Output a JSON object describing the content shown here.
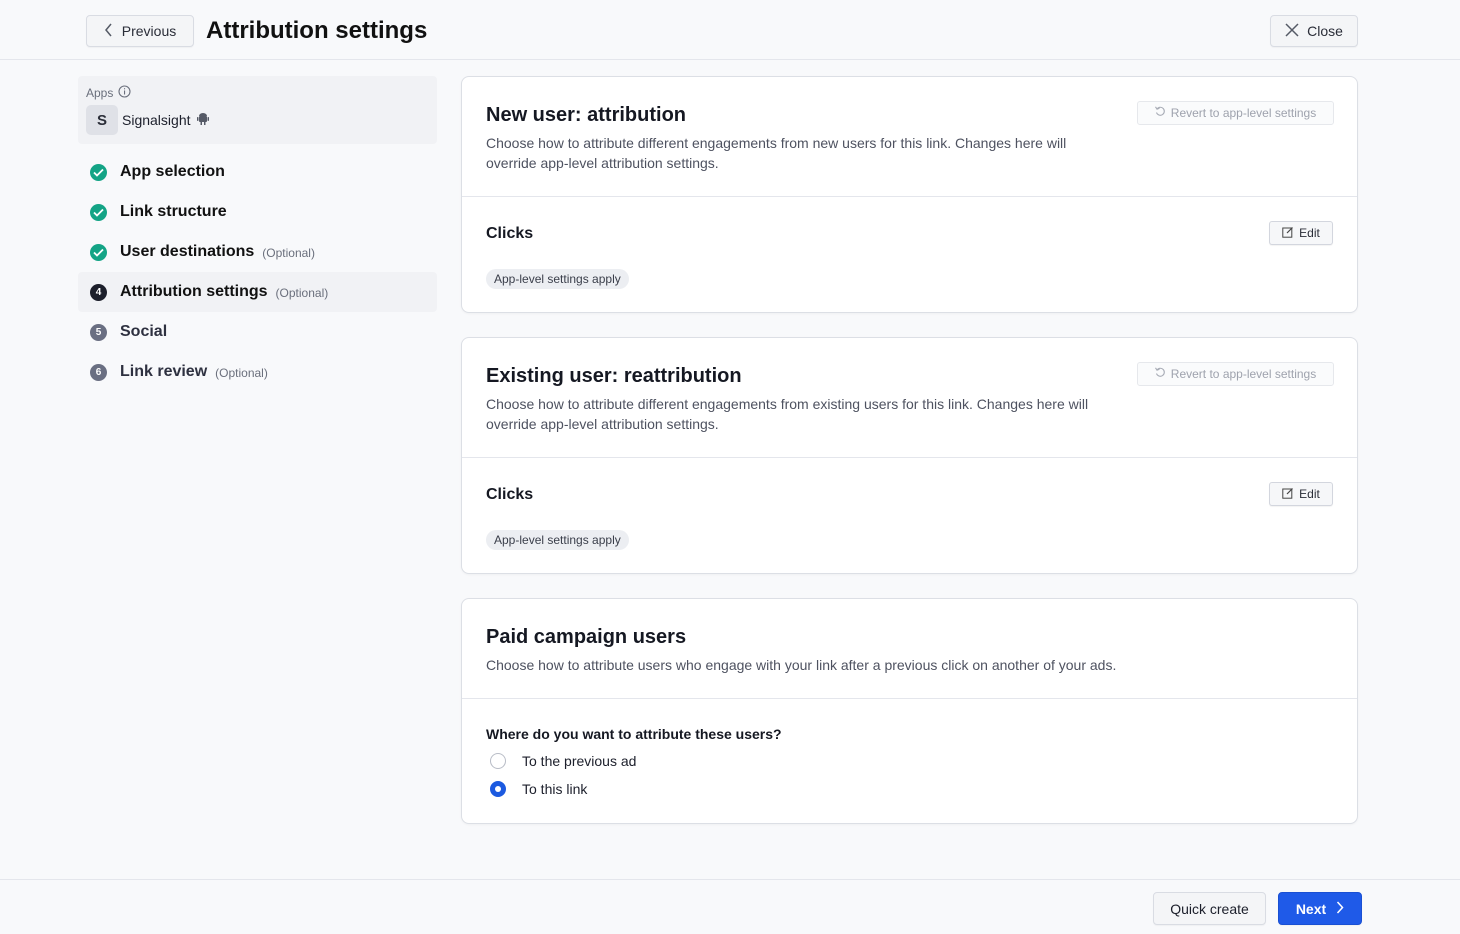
{
  "header": {
    "previous_label": "Previous",
    "title": "Attribution settings",
    "close_label": "Close"
  },
  "sidebar": {
    "apps_label": "Apps",
    "app": {
      "initial": "S",
      "name": "Signalsight",
      "platform_icon": "android-icon"
    },
    "steps": [
      {
        "label": "App selection",
        "optional": "",
        "status": "done",
        "number": ""
      },
      {
        "label": "Link structure",
        "optional": "",
        "status": "done",
        "number": ""
      },
      {
        "label": "User destinations",
        "optional": "(Optional)",
        "status": "done",
        "number": ""
      },
      {
        "label": "Attribution settings",
        "optional": "(Optional)",
        "status": "current",
        "number": "4"
      },
      {
        "label": "Social",
        "optional": "",
        "status": "todo",
        "number": "5"
      },
      {
        "label": "Link review",
        "optional": "(Optional)",
        "status": "todo",
        "number": "6"
      }
    ]
  },
  "cards": {
    "new_user": {
      "title": "New user: attribution",
      "description": "Choose how to attribute different engagements from new users for this link. Changes here will override app-level attribution settings.",
      "revert_label": "Revert to app-level settings",
      "section_label": "Clicks",
      "edit_label": "Edit",
      "badge": "App-level settings apply"
    },
    "existing_user": {
      "title": "Existing user: reattribution",
      "description": "Choose how to attribute different engagements from existing users for this link. Changes here will override app-level attribution settings.",
      "revert_label": "Revert to app-level settings",
      "section_label": "Clicks",
      "edit_label": "Edit",
      "badge": "App-level settings apply"
    },
    "paid_campaign": {
      "title": "Paid campaign users",
      "description": "Choose how to attribute users who engage with your link after a previous click on another of your ads.",
      "question": "Where do you want to attribute these users?",
      "options": [
        {
          "label": "To the previous ad",
          "selected": false
        },
        {
          "label": "To this link",
          "selected": true
        }
      ]
    }
  },
  "footer": {
    "quick_create_label": "Quick create",
    "next_label": "Next"
  },
  "colors": {
    "accent": "#1f5ae8",
    "done": "#14a486",
    "current": "#1c1f2b",
    "todo": "#6a6f82"
  }
}
